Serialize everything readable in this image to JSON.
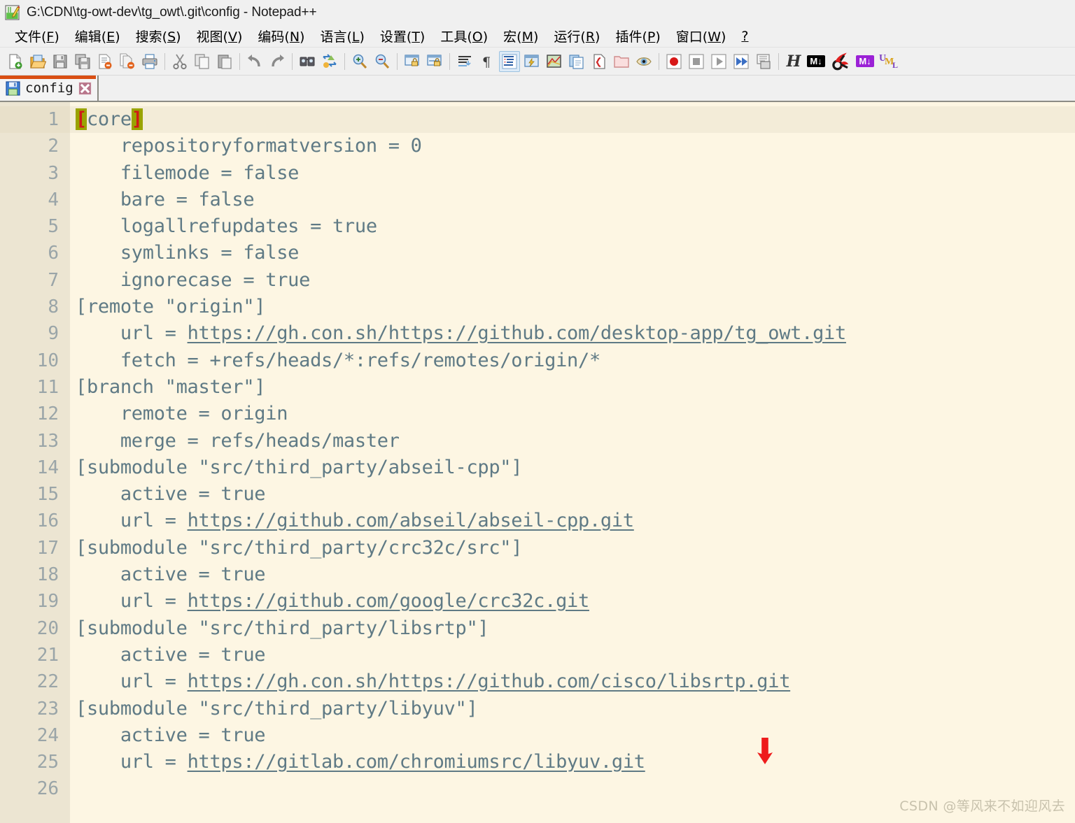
{
  "window": {
    "title": "G:\\CDN\\tg-owt-dev\\tg_owt\\.git\\config - Notepad++",
    "app_icon": "notepad-plus-plus-icon"
  },
  "menubar": {
    "items": [
      {
        "label": "文件",
        "accel": "F"
      },
      {
        "label": "编辑",
        "accel": "E"
      },
      {
        "label": "搜索",
        "accel": "S"
      },
      {
        "label": "视图",
        "accel": "V"
      },
      {
        "label": "编码",
        "accel": "N"
      },
      {
        "label": "语言",
        "accel": "L"
      },
      {
        "label": "设置",
        "accel": "T"
      },
      {
        "label": "工具",
        "accel": "O"
      },
      {
        "label": "宏",
        "accel": "M"
      },
      {
        "label": "运行",
        "accel": "R"
      },
      {
        "label": "插件",
        "accel": "P"
      },
      {
        "label": "窗口",
        "accel": "W"
      },
      {
        "label": "?",
        "accel": ""
      }
    ]
  },
  "toolbar": {
    "icons": [
      "new-file-icon",
      "open-file-icon",
      "save-icon",
      "save-all-icon",
      "close-file-icon",
      "close-all-files-icon",
      "print-icon",
      "sep",
      "cut-icon",
      "copy-icon",
      "paste-icon",
      "sep",
      "undo-icon",
      "redo-icon",
      "sep",
      "find-icon",
      "replace-icon",
      "sep",
      "zoom-in-icon",
      "zoom-out-icon",
      "sep",
      "sync-vertical-scroll-icon",
      "sync-horizontal-scroll-icon",
      "sep",
      "word-wrap-icon",
      "show-all-characters-icon",
      "indent-guideline-icon",
      "user-defined-dialog-icon",
      "document-map-icon",
      "document-list-icon",
      "function-list-icon",
      "folder-as-workspace-icon",
      "monitor-icon",
      "sep",
      "record-macro-icon",
      "stop-recording-icon",
      "play-macro-icon",
      "run-macro-multiple-icon",
      "save-macro-icon",
      "sep",
      "html-tag-icon",
      "markdown-panel-icon",
      "nppexport-icon",
      "markdown-preview-icon",
      "plantuml-icon"
    ],
    "plugin_labels": {
      "html_tag": "H",
      "markdown_black": "M↓",
      "markdown_purple": "M↓",
      "uml_u": "U",
      "uml_m": "M",
      "uml_l": "L"
    },
    "active_icon": "indent-guideline-icon"
  },
  "tabs": [
    {
      "label": "config",
      "active": true,
      "saved_icon": "floppy-save-icon",
      "close_icon": "close-tab-icon"
    }
  ],
  "editor": {
    "total_lines": 26,
    "current_line": 1,
    "lines": [
      {
        "n": 1,
        "segments": [
          {
            "t": "[",
            "cls": "brk"
          },
          {
            "t": "core",
            "cls": ""
          },
          {
            "t": "]",
            "cls": "brk"
          }
        ]
      },
      {
        "n": 2,
        "segments": [
          {
            "t": "    repositoryformatversion = 0",
            "cls": ""
          }
        ]
      },
      {
        "n": 3,
        "segments": [
          {
            "t": "    filemode = false",
            "cls": ""
          }
        ]
      },
      {
        "n": 4,
        "segments": [
          {
            "t": "    bare = false",
            "cls": ""
          }
        ]
      },
      {
        "n": 5,
        "segments": [
          {
            "t": "    logallrefupdates = true",
            "cls": ""
          }
        ]
      },
      {
        "n": 6,
        "segments": [
          {
            "t": "    symlinks = false",
            "cls": ""
          }
        ]
      },
      {
        "n": 7,
        "segments": [
          {
            "t": "    ignorecase = true",
            "cls": ""
          }
        ]
      },
      {
        "n": 8,
        "segments": [
          {
            "t": "[remote \"origin\"]",
            "cls": ""
          }
        ]
      },
      {
        "n": 9,
        "segments": [
          {
            "t": "    url = ",
            "cls": ""
          },
          {
            "t": "https://gh.con.sh/https://github.com/desktop-app/tg_owt.git",
            "cls": "u"
          }
        ]
      },
      {
        "n": 10,
        "segments": [
          {
            "t": "    fetch = +refs/heads/*:refs/remotes/origin/*",
            "cls": ""
          }
        ]
      },
      {
        "n": 11,
        "segments": [
          {
            "t": "[branch \"master\"]",
            "cls": ""
          }
        ]
      },
      {
        "n": 12,
        "segments": [
          {
            "t": "    remote = origin",
            "cls": ""
          }
        ]
      },
      {
        "n": 13,
        "segments": [
          {
            "t": "    merge = refs/heads/master",
            "cls": ""
          }
        ]
      },
      {
        "n": 14,
        "segments": [
          {
            "t": "[submodule \"src/third_party/abseil-cpp\"]",
            "cls": ""
          }
        ]
      },
      {
        "n": 15,
        "segments": [
          {
            "t": "    active = true",
            "cls": ""
          }
        ]
      },
      {
        "n": 16,
        "segments": [
          {
            "t": "    url = ",
            "cls": ""
          },
          {
            "t": "https://github.com/abseil/abseil-cpp.git",
            "cls": "u"
          }
        ]
      },
      {
        "n": 17,
        "segments": [
          {
            "t": "[submodule \"src/third_party/crc32c/src\"]",
            "cls": ""
          }
        ]
      },
      {
        "n": 18,
        "segments": [
          {
            "t": "    active = true",
            "cls": ""
          }
        ]
      },
      {
        "n": 19,
        "segments": [
          {
            "t": "    url = ",
            "cls": ""
          },
          {
            "t": "https://github.com/google/crc32c.git",
            "cls": "u"
          }
        ]
      },
      {
        "n": 20,
        "segments": [
          {
            "t": "[submodule \"src/third_party/libsrtp\"]",
            "cls": ""
          }
        ]
      },
      {
        "n": 21,
        "segments": [
          {
            "t": "    active = true",
            "cls": ""
          }
        ]
      },
      {
        "n": 22,
        "segments": [
          {
            "t": "    url = ",
            "cls": ""
          },
          {
            "t": "https://gh.con.sh/https://github.com/cisco/libsrtp.git",
            "cls": "u"
          }
        ]
      },
      {
        "n": 23,
        "segments": [
          {
            "t": "[submodule \"src/third_party/libyuv\"]",
            "cls": ""
          }
        ]
      },
      {
        "n": 24,
        "segments": [
          {
            "t": "    active = true",
            "cls": ""
          }
        ]
      },
      {
        "n": 25,
        "segments": [
          {
            "t": "    url = ",
            "cls": ""
          },
          {
            "t": "https://gitlab.com/chromiumsrc/libyuv.git",
            "cls": "u"
          }
        ]
      },
      {
        "n": 26,
        "segments": [
          {
            "t": "",
            "cls": ""
          }
        ]
      }
    ]
  },
  "annotation": {
    "arrow_icon": "red-down-arrow-icon",
    "arrow_color": "#ee1c1c"
  },
  "watermark": {
    "text": "CSDN @等风来不如迎风去"
  },
  "colors": {
    "editor_bg": "#fdf6e3",
    "gutter_bg": "#ece5d2",
    "current_line_bg": "#f3ecd8",
    "text": "#5f7a85",
    "line_number": "#9aa5a8",
    "bracket_highlight_bg": "#9aa300",
    "bracket_highlight_fg": "#cf1a16",
    "tab_active_accent": "#d94e12",
    "chrome_bg": "#f0f0f0"
  }
}
